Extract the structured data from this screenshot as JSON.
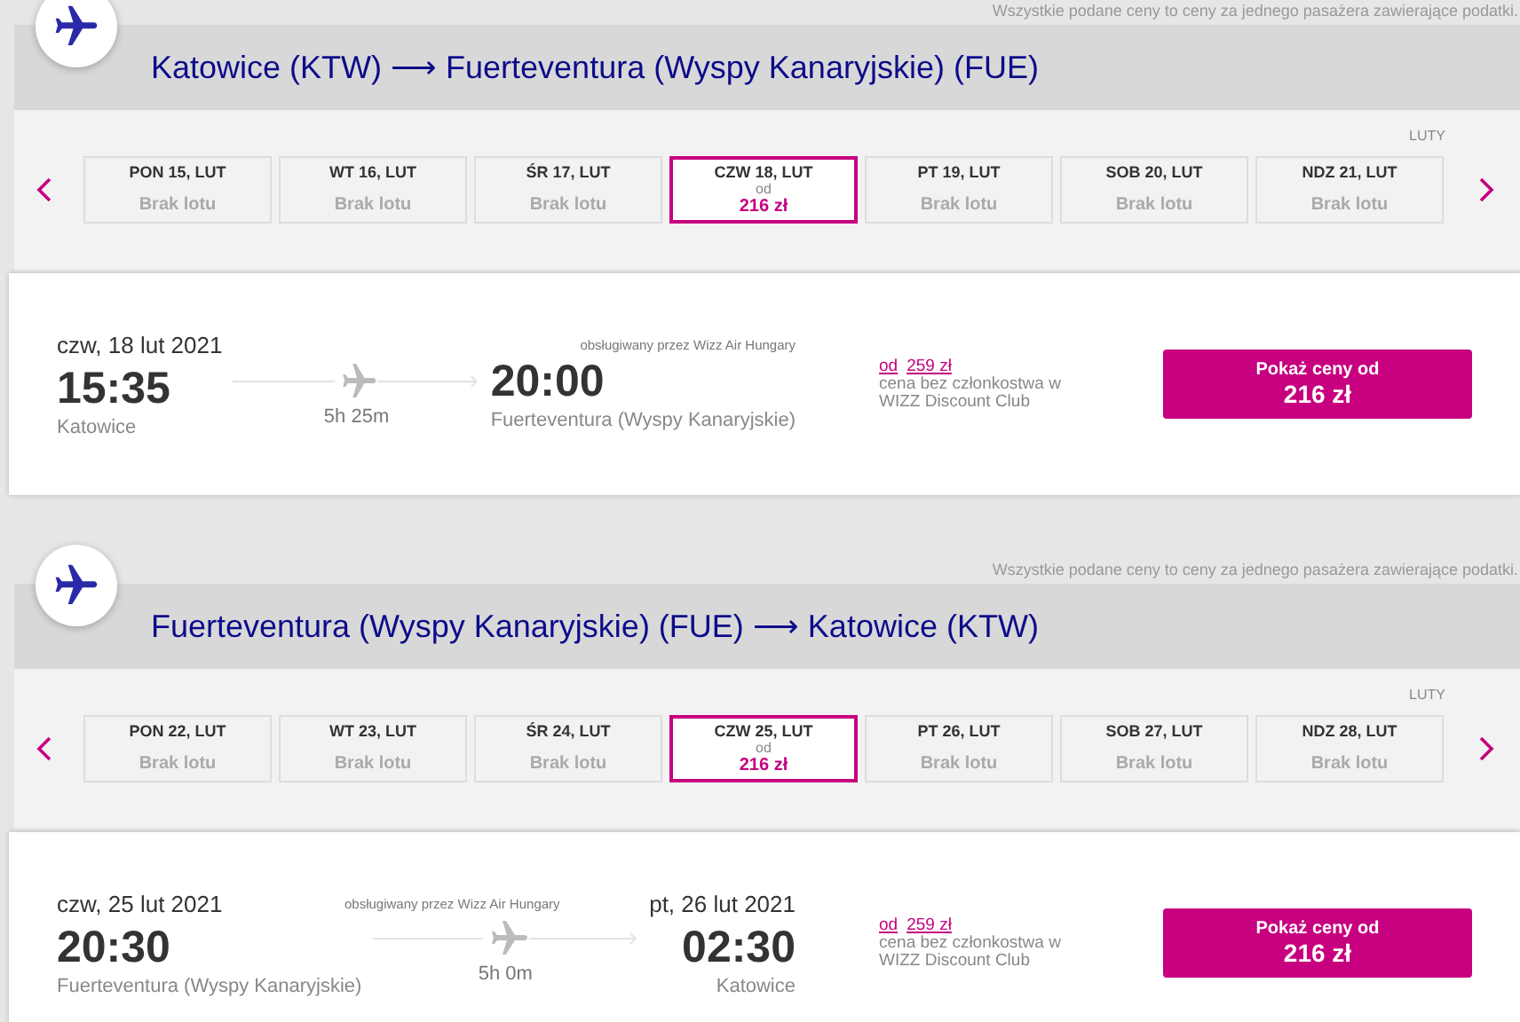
{
  "sections": [
    {
      "notice": "Wszystkie podane ceny to ceny za jednego pasażera zawierające podatki.",
      "title": "Katowice (KTW) ⟶ Fuerteventura (Wyspy Kanaryjskie) (FUE)",
      "month": "LUTY",
      "days": [
        {
          "label": "PON 15, LUT",
          "kind": "none",
          "status": "Brak lotu",
          "selected": false
        },
        {
          "label": "WT 16, LUT",
          "kind": "none",
          "status": "Brak lotu",
          "selected": false
        },
        {
          "label": "ŚR 17, LUT",
          "kind": "none",
          "status": "Brak lotu",
          "selected": false
        },
        {
          "label": "CZW 18, LUT",
          "kind": "price",
          "prefix": "od",
          "status": "216 zł",
          "selected": true
        },
        {
          "label": "PT 19, LUT",
          "kind": "none",
          "status": "Brak lotu",
          "selected": false
        },
        {
          "label": "SOB 20, LUT",
          "kind": "none",
          "status": "Brak lotu",
          "selected": false
        },
        {
          "label": "NDZ 21, LUT",
          "kind": "none",
          "status": "Brak lotu",
          "selected": false
        }
      ],
      "flight": {
        "departure_date": "czw, 18 lut 2021",
        "departure_time": "15:35",
        "departure_city": "Katowice",
        "duration": "5h 25m",
        "operator": "obsługiwany przez Wizz Air Hungary",
        "arrival_time": "20:00",
        "arrival_city": "Fuerteventura (Wyspy Kanaryjskie)",
        "member_prefix": "od",
        "member_price": "259 zł",
        "member_note": "cena bez członkostwa w WIZZ Discount Club",
        "button_label": "Pokaż ceny od",
        "button_price": "216 zł"
      }
    },
    {
      "notice": "Wszystkie podane ceny to ceny za jednego pasażera zawierające podatki.",
      "title": "Fuerteventura (Wyspy Kanaryjskie) (FUE) ⟶ Katowice (KTW)",
      "month": "LUTY",
      "days": [
        {
          "label": "PON 22, LUT",
          "kind": "none",
          "status": "Brak lotu",
          "selected": false
        },
        {
          "label": "WT 23, LUT",
          "kind": "none",
          "status": "Brak lotu",
          "selected": false
        },
        {
          "label": "ŚR 24, LUT",
          "kind": "none",
          "status": "Brak lotu",
          "selected": false
        },
        {
          "label": "CZW 25, LUT",
          "kind": "price",
          "prefix": "od",
          "status": "216 zł",
          "selected": true
        },
        {
          "label": "PT 26, LUT",
          "kind": "none",
          "status": "Brak lotu",
          "selected": false
        },
        {
          "label": "SOB 27, LUT",
          "kind": "none",
          "status": "Brak lotu",
          "selected": false
        },
        {
          "label": "NDZ 28, LUT",
          "kind": "none",
          "status": "Brak lotu",
          "selected": false
        }
      ],
      "flight": {
        "departure_date": "czw, 25 lut 2021",
        "departure_time": "20:30",
        "departure_city": "Fuerteventura (Wyspy Kanaryjskie)",
        "duration": "5h 0m",
        "operator": "obsługiwany przez Wizz Air Hungary",
        "arrival_date": "pt, 26 lut 2021",
        "arrival_time": "02:30",
        "arrival_city": "Katowice",
        "member_prefix": "od",
        "member_price": "259 zł",
        "member_note": "cena bez członkostwa w WIZZ Discount Club",
        "button_label": "Pokaż ceny od",
        "button_price": "216 zł"
      }
    }
  ]
}
